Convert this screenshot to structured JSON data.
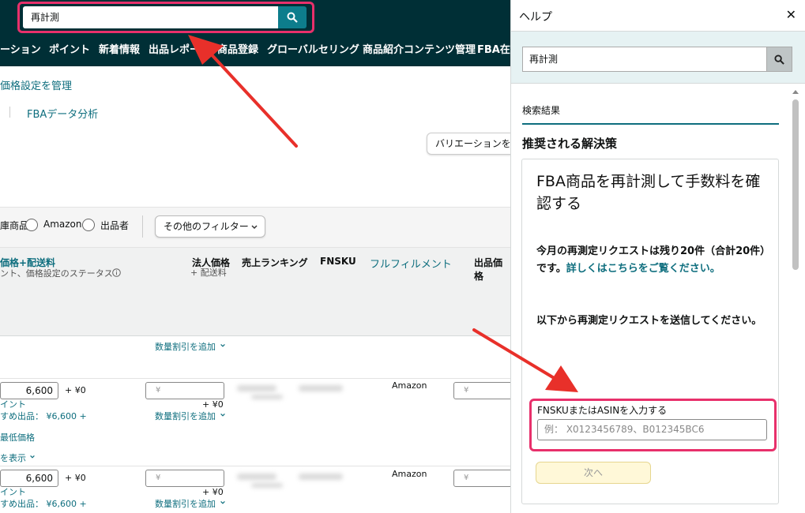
{
  "search": {
    "value": "再計測"
  },
  "nav": {
    "items": [
      "ーション",
      "ポイント",
      "新着情報",
      "出品レポー",
      "商品登録",
      "グローバルセリング",
      "商品紹介コンテンツ管理",
      "FBA在庫"
    ]
  },
  "page": {
    "price_settings_link": "価格設定を管理",
    "fba_analysis_link": "FBAデータ分析",
    "variation_button": "バリエーションを",
    "filters": {
      "products_label": "庫商品",
      "amazon_label": "Amazon",
      "seller_label": "出品者",
      "more_filters": "その他のフィルター"
    },
    "columns": {
      "price_shipping": "価格+配送料",
      "price_status": "ント、価格設定のステータス",
      "business_price": "法人価格",
      "plus_shipping": "+ 配送料",
      "sales_rank": "売上ランキング",
      "fnsku": "FNSKU",
      "fulfillment": "フルフィルメント",
      "listing_price": "出品価格"
    },
    "add_quantity_discount": "数量割引を追加",
    "rows": [
      {
        "price": "6,600",
        "plus_zero": "+ ¥0",
        "yen_placeholder": "¥",
        "points": "イント",
        "recommended": "すめ出品： ¥6,600 +",
        "plus_zero_right": "+ ¥0",
        "fulfillment": "Amazon"
      },
      {
        "price": "6,600",
        "plus_zero": "+ ¥0",
        "yen_placeholder": "¥",
        "points": "イント",
        "recommended": "すめ出品： ¥6,600 +",
        "plus_zero_right": "+ ¥0",
        "fulfillment": "Amazon"
      }
    ],
    "min_price": "最低価格",
    "show_more": "を表示"
  },
  "help": {
    "title": "ヘルプ",
    "search_value": "再計測",
    "results_label": "検索結果",
    "recommended_solutions": "推奨される解決策",
    "card": {
      "title": "FBA商品を再計測して手数料を確認する",
      "remaining_text": "今月の再測定リクエストは残り20件（合計20件）です。",
      "details_link": "詳しくはこちらをご覧ください。",
      "send_text": "以下から再測定リクエストを送信してください。",
      "input_label": "FNSKUまたはASINを入力する",
      "input_placeholder": "例： X0123456789、B012345BC6",
      "next_button": "次へ"
    }
  },
  "colors": {
    "topbar": "#002f36",
    "highlight": "#e8306b",
    "arrow": "#e8302a",
    "link": "#0e6e7e"
  }
}
